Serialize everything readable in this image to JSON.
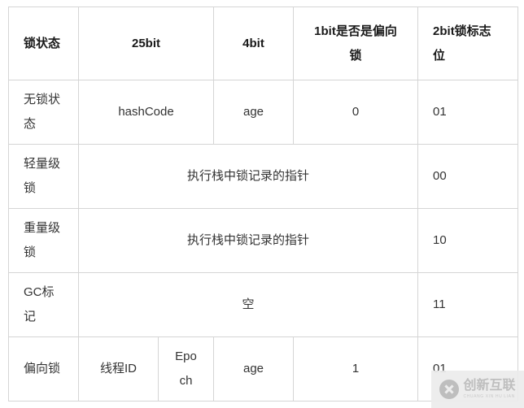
{
  "table": {
    "headers": [
      {
        "label": "锁状态",
        "align": "left"
      },
      {
        "label": "25bit",
        "align": "center"
      },
      {
        "label": "4bit",
        "align": "center"
      },
      {
        "label": "1bit是否是偏向锁",
        "align": "center"
      },
      {
        "label": "2bit锁标志位",
        "align": "left"
      }
    ],
    "rows": [
      {
        "state": "无锁状态",
        "cells": [
          {
            "text": "hashCode",
            "align": "center"
          },
          {
            "text": "age",
            "align": "center"
          },
          {
            "text": "0",
            "align": "center"
          },
          {
            "text": "01",
            "align": "left"
          }
        ]
      },
      {
        "state": "轻量级锁",
        "cells": [
          {
            "text": "执行栈中锁记录的指针",
            "align": "center"
          },
          {
            "text": "00",
            "align": "left"
          }
        ]
      },
      {
        "state": "重量级锁",
        "cells": [
          {
            "text": "执行栈中锁记录的指针",
            "align": "center"
          },
          {
            "text": "10",
            "align": "left"
          }
        ]
      },
      {
        "state": "GC标记",
        "cells": [
          {
            "text": "空",
            "align": "center"
          },
          {
            "text": "11",
            "align": "left"
          }
        ]
      },
      {
        "state": "偏向锁",
        "cells": [
          {
            "text": "线程ID",
            "align": "center"
          },
          {
            "text": "Epoch",
            "align": "center"
          },
          {
            "text": "age",
            "align": "center"
          },
          {
            "text": "1",
            "align": "center"
          },
          {
            "text": "01",
            "align": "left"
          }
        ]
      }
    ]
  },
  "watermark": {
    "cn": "创新互联",
    "en": "CHUANG XIN HU LIAN"
  },
  "colors": {
    "border": "#d5d5d5",
    "text": "#333333",
    "header_text": "#1a1a1a",
    "background": "#ffffff",
    "watermark_bg": "#ececec",
    "watermark_fg": "#b9b9b9"
  }
}
